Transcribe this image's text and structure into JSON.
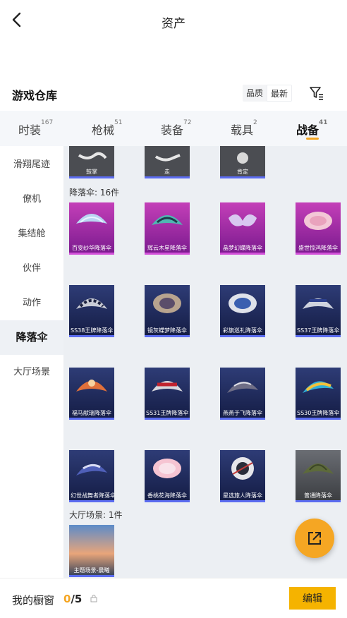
{
  "header": {
    "title": "资产"
  },
  "warehouse": {
    "title": "游戏仓库",
    "sort_options": [
      "品质",
      "最新"
    ],
    "active_sort": "最新"
  },
  "tabs": [
    {
      "label": "时装",
      "count": "167"
    },
    {
      "label": "枪械",
      "count": "51"
    },
    {
      "label": "装备",
      "count": "72"
    },
    {
      "label": "载具",
      "count": "2"
    },
    {
      "label": "战备",
      "count": "41",
      "active": true
    }
  ],
  "sidebar": {
    "items": [
      {
        "label": "滑翔尾迹"
      },
      {
        "label": "僚机"
      },
      {
        "label": "集结舱"
      },
      {
        "label": "伙伴"
      },
      {
        "label": "动作"
      },
      {
        "label": "降落伞",
        "active": true
      },
      {
        "label": "大厅场景"
      }
    ]
  },
  "content": {
    "emotes": [
      {
        "name": "鼓掌",
        "icon": "clap-gesture-icon"
      },
      {
        "name": "走",
        "icon": "walk-gesture-icon"
      },
      {
        "name": "肯定",
        "icon": "nod-gesture-icon"
      }
    ],
    "parachute_section": "降落伞: 16件",
    "parachutes": [
      {
        "name": "百变纱华降落伞",
        "rarity": "pink"
      },
      {
        "name": "辉云木星降落伞",
        "rarity": "pink"
      },
      {
        "name": "晶梦幻蝶降落伞",
        "rarity": "pink"
      },
      {
        "name": "盛世惊鸿降落伞",
        "rarity": "pink"
      },
      {
        "name": "SS38王牌降落伞",
        "rarity": "blue"
      },
      {
        "name": "镜灰蝶梦降落伞",
        "rarity": "blue"
      },
      {
        "name": "彩旗巡礼降落伞",
        "rarity": "blue"
      },
      {
        "name": "SS37王牌降落伞",
        "rarity": "blue"
      },
      {
        "name": "福马献瑞降落伞",
        "rarity": "blue"
      },
      {
        "name": "SS31王牌降落伞",
        "rarity": "blue"
      },
      {
        "name": "燕燕于飞降落伞",
        "rarity": "blue"
      },
      {
        "name": "SS30王牌降落伞",
        "rarity": "blue"
      },
      {
        "name": "幻世战舞者降落伞",
        "rarity": "blue"
      },
      {
        "name": "香桃花海降落伞",
        "rarity": "blue"
      },
      {
        "name": "星选旅人降落伞",
        "rarity": "blue"
      },
      {
        "name": "普通降落伞",
        "rarity": "gray"
      }
    ],
    "scene_section": "大厅场景: 1件",
    "scenes": [
      {
        "name": "主题场景-晨曦"
      }
    ]
  },
  "footer": {
    "label": "我的橱窗",
    "current": "0",
    "total": "/5",
    "edit_label": "编辑"
  },
  "colors": {
    "accent": "#f5a623",
    "legendary": "#d24fd8",
    "epic": "#5b6cf0"
  }
}
